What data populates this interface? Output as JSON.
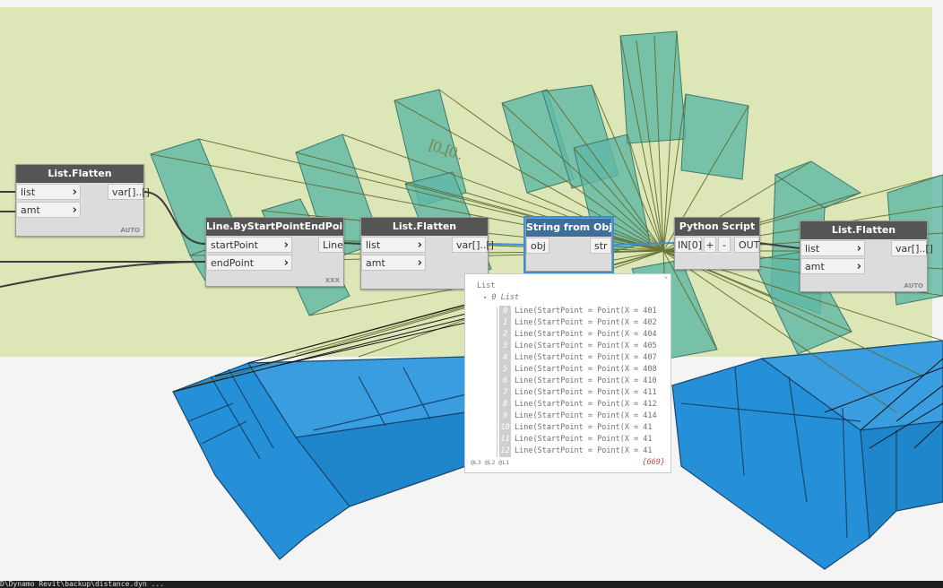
{
  "colors": {
    "group_background": "#dde6b6",
    "building_teal": "#5fb8a6",
    "base_blue": "#2590d8",
    "line_olive": "#5f6a2c",
    "node_header": "#555555",
    "selection": "#3a8fd8"
  },
  "background_text": "[0..[0..",
  "nodes": {
    "flatten_left": {
      "title": "List.Flatten",
      "inputs": [
        "list",
        "amt"
      ],
      "output": "var[]..[]",
      "lacing": "AUTO"
    },
    "line_node": {
      "title": "Line.ByStartPointEndPoint",
      "inputs": [
        "startPoint",
        "endPoint"
      ],
      "output": "Line",
      "lacing": "XXX"
    },
    "flatten_mid": {
      "title": "List.Flatten",
      "inputs": [
        "list",
        "amt"
      ],
      "output": "var[]..[]"
    },
    "string_node": {
      "title": "String from Object",
      "input": "obj",
      "output": "str"
    },
    "python_node": {
      "title": "Python Script",
      "input": "IN[0]",
      "add": "+",
      "remove": "-",
      "output": "OUT"
    },
    "flatten_right": {
      "title": "List.Flatten",
      "inputs": [
        "list",
        "amt"
      ],
      "output": "var[]..[]",
      "lacing": "AUTO"
    }
  },
  "watch": {
    "root": "List",
    "sub": "0 List",
    "close": "×",
    "rows": [
      {
        "idx": "0",
        "val": "Line(StartPoint = Point(X = 401"
      },
      {
        "idx": "1",
        "val": "Line(StartPoint = Point(X = 402"
      },
      {
        "idx": "2",
        "val": "Line(StartPoint = Point(X = 404"
      },
      {
        "idx": "3",
        "val": "Line(StartPoint = Point(X = 405"
      },
      {
        "idx": "4",
        "val": "Line(StartPoint = Point(X = 407"
      },
      {
        "idx": "5",
        "val": "Line(StartPoint = Point(X = 408"
      },
      {
        "idx": "6",
        "val": "Line(StartPoint = Point(X = 410"
      },
      {
        "idx": "7",
        "val": "Line(StartPoint = Point(X = 411"
      },
      {
        "idx": "8",
        "val": "Line(StartPoint = Point(X = 412"
      },
      {
        "idx": "9",
        "val": "Line(StartPoint = Point(X = 414"
      },
      {
        "idx": "10",
        "val": "Line(StartPoint = Point(X = 41"
      },
      {
        "idx": "11",
        "val": "Line(StartPoint = Point(X = 41"
      },
      {
        "idx": "12",
        "val": "Line(StartPoint = Point(X = 41"
      }
    ],
    "levels": "@L3 @L2 @L1",
    "count": "{669}"
  },
  "status_path": "D\\Dynamo Revit\\backup\\distance.dyn ..."
}
